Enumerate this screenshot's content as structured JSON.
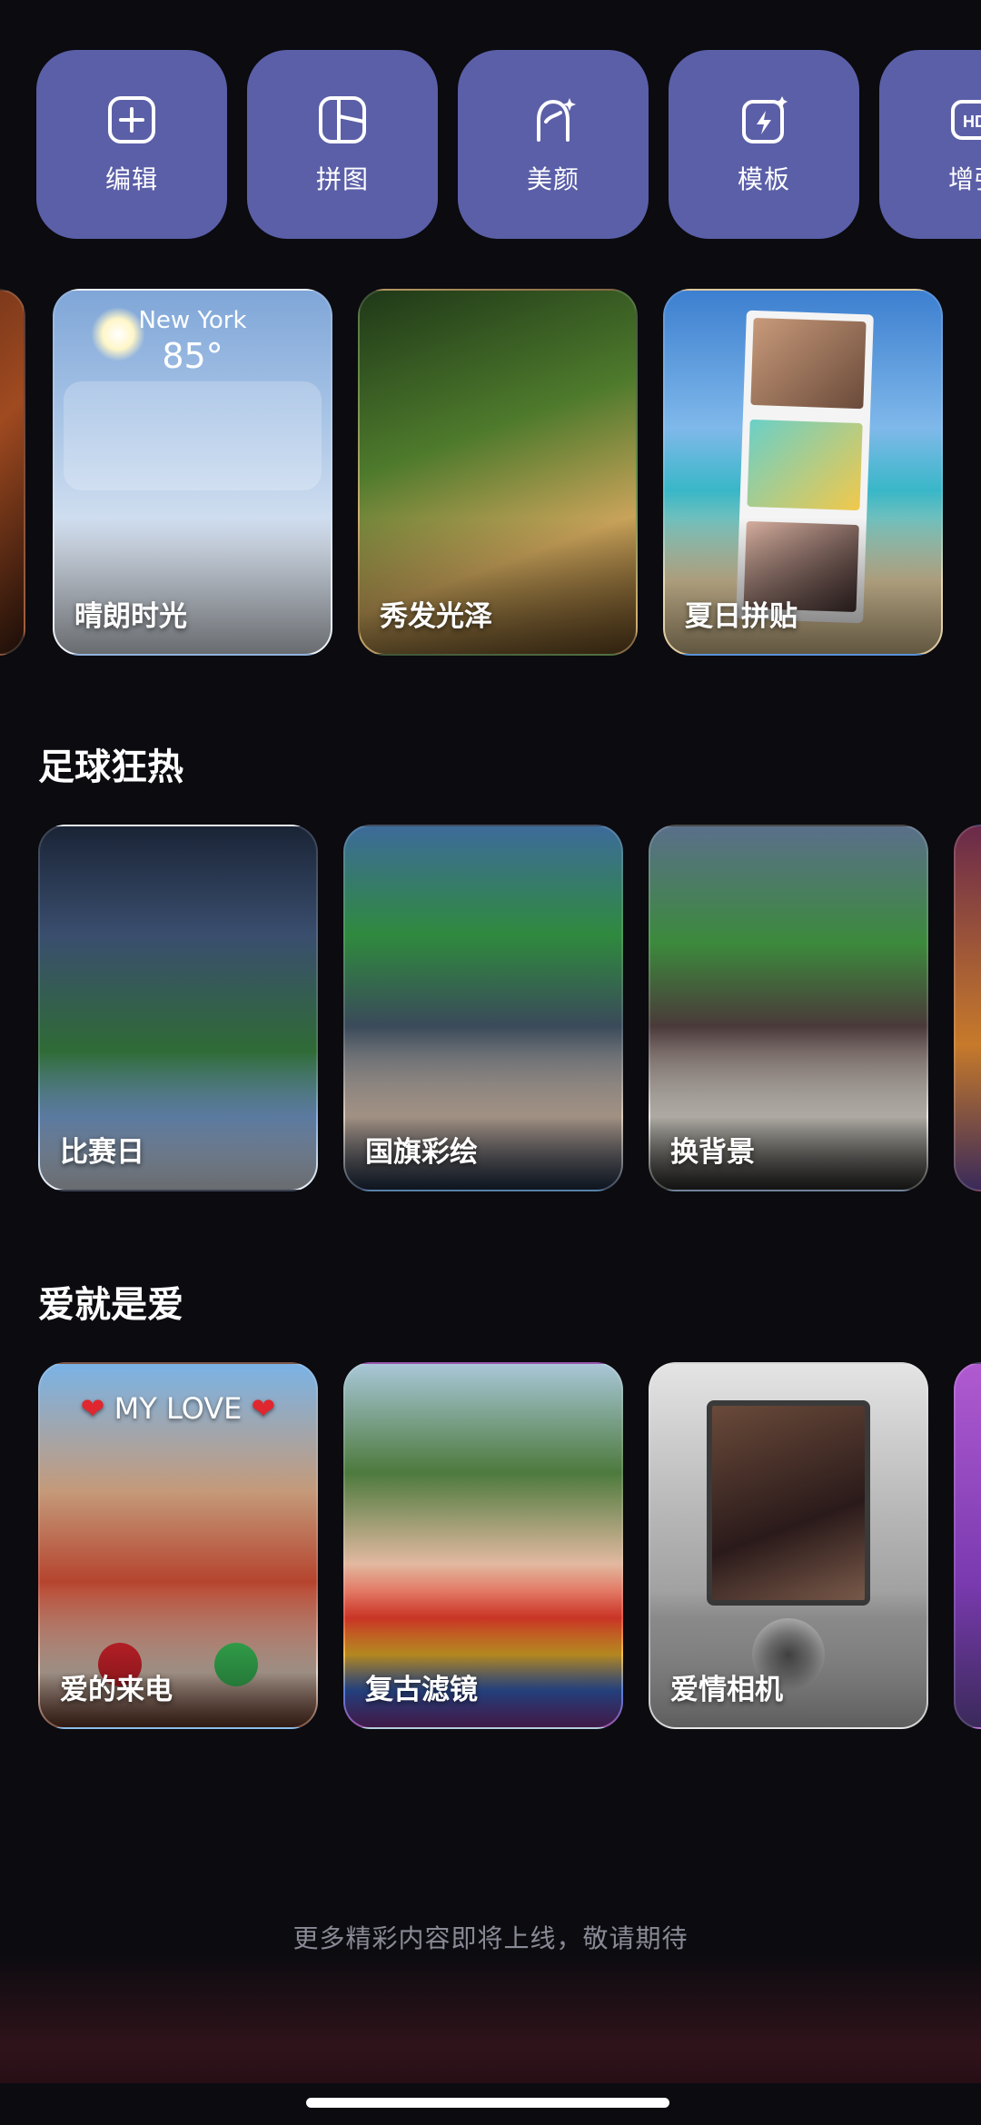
{
  "tools": [
    {
      "label": "编辑",
      "icon": "add-square-icon"
    },
    {
      "label": "拼图",
      "icon": "collage-icon"
    },
    {
      "label": "美颜",
      "icon": "beauty-face-icon"
    },
    {
      "label": "模板",
      "icon": "template-flash-icon"
    },
    {
      "label": "增强",
      "icon": "hd-icon",
      "icon_text": "HD"
    }
  ],
  "featured": {
    "cards": [
      {
        "label": "晴朗时光",
        "city": "New York",
        "temp": "85°"
      },
      {
        "label": "秀发光泽"
      },
      {
        "label": "夏日拼贴"
      }
    ]
  },
  "sections": [
    {
      "title": "足球狂热",
      "cards": [
        {
          "label": "比赛日"
        },
        {
          "label": "国旗彩绘"
        },
        {
          "label": "换背景"
        }
      ]
    },
    {
      "title": "爱就是爱",
      "cards": [
        {
          "label": "爱的来电",
          "banner": "MY LOVE"
        },
        {
          "label": "复古滤镜"
        },
        {
          "label": "爱情相机"
        }
      ]
    }
  ],
  "footer": {
    "text": "更多精彩内容即将上线，敬请期待"
  },
  "colors": {
    "tool_bg": "#5b5fa8",
    "page_bg": "#0b0b10",
    "footer_text": "#8a8a96"
  }
}
